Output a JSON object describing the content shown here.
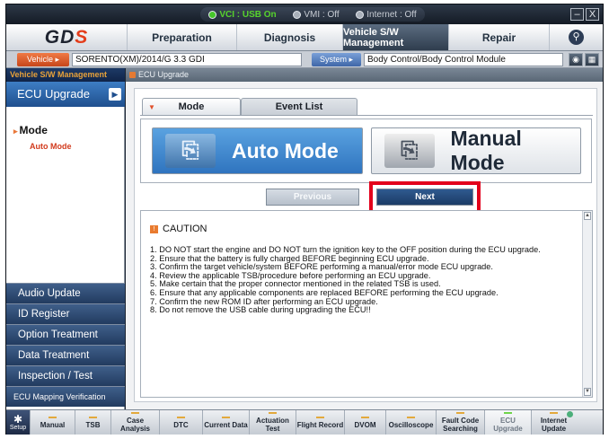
{
  "status": {
    "vci": "VCI : USB On",
    "vmi": "VMI : Off",
    "internet": "Internet : Off",
    "minimize": "–",
    "close": "X"
  },
  "topnav": {
    "logo_main": "GD",
    "logo_s": "S",
    "tabs": [
      "Preparation",
      "Diagnosis",
      "Vehicle S/W Management",
      "Repair"
    ],
    "search_icon": "search-icon"
  },
  "vehicle_row": {
    "vehicle_label": "Vehicle ▸",
    "vehicle_value": "SORENTO(XM)/2014/G 3.3 GDI",
    "system_label": "System ▸",
    "system_value": "Body Control/Body Control Module"
  },
  "sidebar": {
    "title": "Vehicle S/W Management",
    "active": "ECU Upgrade",
    "mode": "Mode",
    "auto_mode": "Auto Mode",
    "items": [
      "Audio Update",
      "ID Register",
      "Option Treatment",
      "Data Treatment",
      "Inspection / Test",
      "ECU Mapping Verification"
    ]
  },
  "main": {
    "breadcrumb": "ECU Upgrade",
    "tabs": [
      "Mode",
      "Event List"
    ],
    "auto_mode_button": "Auto Mode",
    "manual_mode_button": "Manual Mode",
    "previous_button": "Previous",
    "next_button": "Next",
    "caution_title": "CAUTION",
    "caution_items": [
      "1. DO NOT start the engine and DO NOT turn the ignition key to the OFF position during the ECU upgrade.",
      "2. Ensure that the battery is fully charged BEFORE beginning ECU upgrade.",
      "3. Confirm the target vehicle/system BEFORE performing a manual/error mode ECU upgrade.",
      "4. Review the applicable TSB/procedure before performing an ECU upgrade.",
      "5. Make certain that the proper connector mentioned in the related TSB is used.",
      "6. Ensure that any applicable components are replaced BEFORE performing the ECU upgrade.",
      "7. Confirm the new ROM ID after performing an ECU upgrade.",
      "8. Do not remove the USB cable during upgrading the ECU!!"
    ]
  },
  "toolbar": {
    "setup": "Setup",
    "tools": [
      "Manual",
      "TSB",
      "Case Analysis",
      "DTC",
      "Current Data",
      "Actuation Test",
      "Flight Record",
      "DVOM",
      "Oscilloscope",
      "Fault Code Searching",
      "ECU Upgrade",
      "Internet Update"
    ]
  },
  "colors": {
    "highlight": "#e3001b",
    "accent_orange": "#e9783a",
    "active_blue": "#2f74bf"
  }
}
